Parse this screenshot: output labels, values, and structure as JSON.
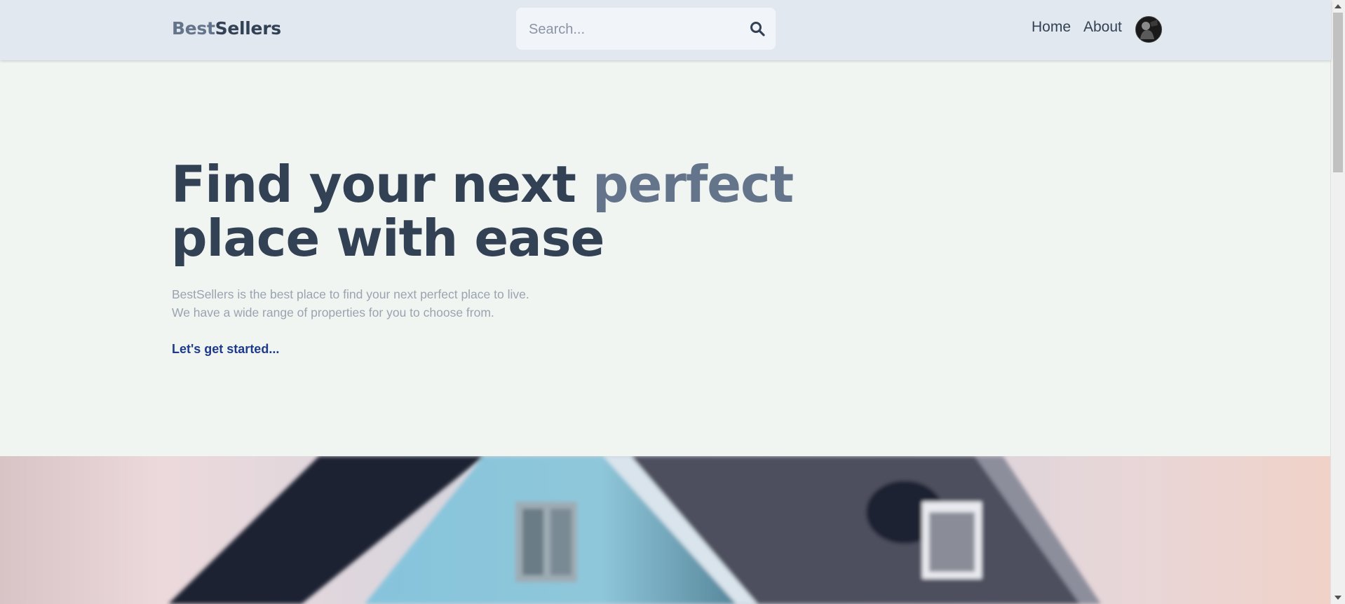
{
  "header": {
    "logo_part1": "Best",
    "logo_part2": "Sellers",
    "search_placeholder": "Search...",
    "nav": {
      "home": "Home",
      "about": "About"
    }
  },
  "hero": {
    "title_part1": "Find your next ",
    "title_accent": "perfect",
    "title_part2": "place with ease",
    "description_line1": "BestSellers is the best place to find your next perfect place to live.",
    "description_line2": "We have a wide range of properties for you to choose from.",
    "cta_label": "Let's get started..."
  },
  "colors": {
    "header_bg": "#e2e8f0",
    "page_bg": "#f1f5f1",
    "heading": "#334155",
    "accent": "#64748b",
    "cta": "#1e3a8a"
  },
  "icons": {
    "search": "search-icon",
    "avatar": "user-avatar"
  }
}
